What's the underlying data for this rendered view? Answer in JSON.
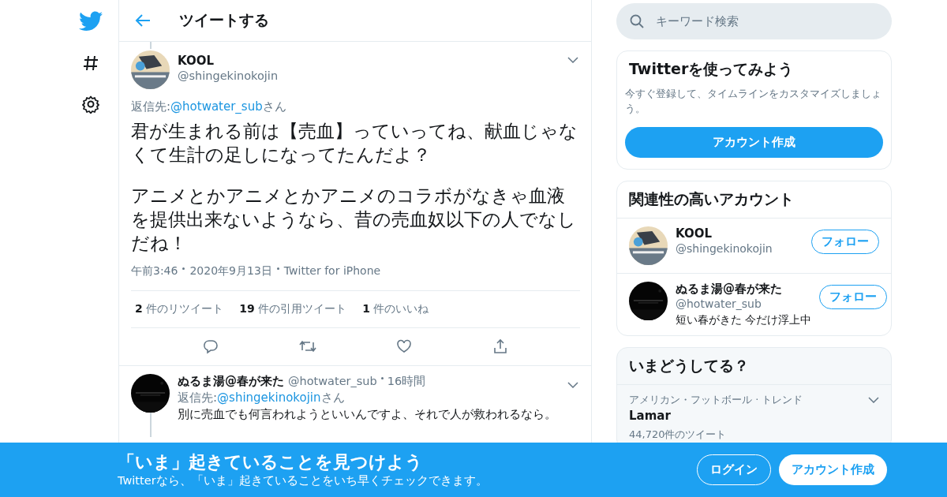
{
  "nav": {
    "items": [
      {
        "kind": "logo"
      },
      {
        "kind": "explore"
      },
      {
        "kind": "settings"
      }
    ]
  },
  "header": {
    "title": "ツイートする"
  },
  "tweet": {
    "name": "KOOL",
    "handle": "@shingekinokojin",
    "reply_label": "返信先:",
    "reply_to": "@hotwater_sub",
    "reply_suffix": "さん",
    "paragraphs": [
      "君が生まれる前は【売血】っていってね、献血じゃなくて生計の足しになってたんだよ？",
      "アニメとかアニメとかアニメのコラボがなきゃ血液を提供出来ないようなら、昔の売血奴以下の人でなしだね！"
    ],
    "meta": [
      "午前3:46",
      "2020年9月13日",
      "Twitter for iPhone"
    ],
    "stats": [
      {
        "count": "2",
        "label": "件のリツイート"
      },
      {
        "count": "19",
        "label": "件の引用ツイート"
      },
      {
        "count": "1",
        "label": "件のいいね"
      }
    ]
  },
  "reply": {
    "name": "ぬるま湯@春が来た",
    "handle": "@hotwater_sub",
    "time": "16時間",
    "reply_label": "返信先:",
    "reply_to": "@shingekinokojin",
    "reply_suffix": "さん",
    "text": "別に売血でも何言われようといいんですよ、それで人が救われるなら。"
  },
  "search": {
    "placeholder": "キーワード検索"
  },
  "signup_card": {
    "title": "Twitterを使ってみよう",
    "text": "今すぐ登録して、タイムラインをカスタマイズしましょう。",
    "button": "アカウント作成"
  },
  "related": {
    "title": "関連性の高いアカウント",
    "accounts": [
      {
        "name": "KOOL",
        "handle": "@shingekinokojin",
        "button": "フォロー"
      },
      {
        "name": "ぬるま湯@春が来た",
        "handle": "@hotwater_sub",
        "button": "フォロー",
        "bio": "短い春がきた 今だけ浮上中"
      }
    ]
  },
  "trends": {
    "title": "いまどうしてる？",
    "items": [
      {
        "context": "アメリカン・フットボール · トレンド",
        "name": "Lamar",
        "count": "44,720件のツイート"
      }
    ]
  },
  "banner": {
    "title": "「いま」起きていることを見つけよう",
    "text": "Twitterなら、「いま」起きていることをいち早くチェックできます。",
    "login": "ログイン",
    "signup": "アカウント作成"
  }
}
